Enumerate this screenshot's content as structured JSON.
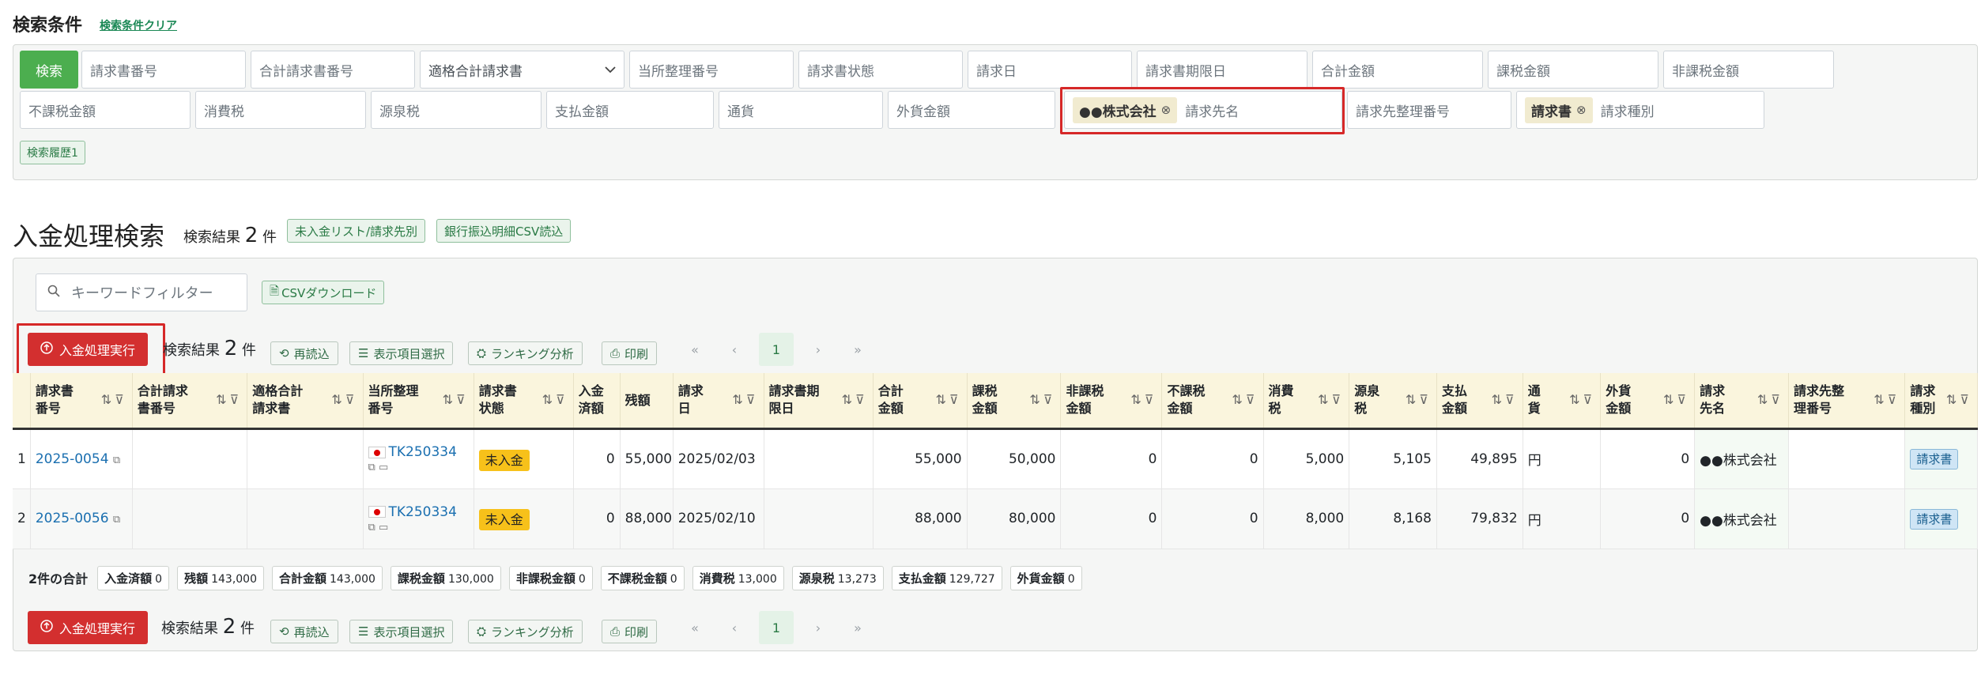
{
  "search": {
    "title": "検索条件",
    "clear": "検索条件クリア",
    "search_btn": "検索",
    "row1": [
      "請求書番号",
      "合計請求書番号",
      "適格合計請求書",
      "当所整理番号",
      "請求書状態",
      "請求日",
      "請求書期限日",
      "合計金額",
      "課税金額",
      "非課税金額"
    ],
    "row2": [
      "不課税金額",
      "消費税",
      "源泉税",
      "支払金額",
      "通貨",
      "外貨金額"
    ],
    "chip_company": "●●株式会社",
    "company_placeholder": "請求先名",
    "ref_no": "請求先整理番号",
    "chip_type": "請求書",
    "type_placeholder": "請求種別",
    "history_btn": "検索履歴1",
    "chevron": "chevron-down-icon",
    "remove": "⊗"
  },
  "heading": {
    "title": "入金処理検索",
    "result_prefix": "検索結果",
    "count": "2",
    "unit": "件",
    "btn_unpaid": "未入金リスト/請求先別",
    "btn_bank": "銀行振込明細CSV読込"
  },
  "toolbar": {
    "keyword_placeholder": "キーワードフィルター",
    "csv": "CSVダウンロード",
    "exec": "入金処理実行",
    "result_prefix": "検索結果",
    "count": "2",
    "unit": "件",
    "reload": "再読込",
    "columns": "表示項目選択",
    "ranking": "ランキング分析",
    "print": "印刷",
    "page_first": "«",
    "page_prev": "‹",
    "page_cur": "1",
    "page_next": "›",
    "page_last": "»"
  },
  "table": {
    "headers": [
      "請求書番号",
      "合計請求書番号",
      "適格合計請求書",
      "当所整理番号",
      "請求書状態",
      "入金済額",
      "残額",
      "請求日",
      "請求書期限日",
      "合計金額",
      "課税金額",
      "非課税金額",
      "不課税金額",
      "消費税",
      "源泉税",
      "支払金額",
      "通貨",
      "外貨金額",
      "請求先名",
      "請求先整理番号",
      "請求種別"
    ],
    "header_lines": [
      [
        "請求書",
        "番号"
      ],
      [
        "合計請求",
        "書番号"
      ],
      [
        "適格合計",
        "請求書"
      ],
      [
        "当所整理",
        "番号"
      ],
      [
        "請求書",
        "状態"
      ],
      [
        "入金",
        "済額"
      ],
      [
        "残額"
      ],
      [
        "請求",
        "日"
      ],
      [
        "請求書期",
        "限日"
      ],
      [
        "合計",
        "金額"
      ],
      [
        "課税",
        "金額"
      ],
      [
        "非課税",
        "金額"
      ],
      [
        "不課税",
        "金額"
      ],
      [
        "消費",
        "税"
      ],
      [
        "源泉",
        "税"
      ],
      [
        "支払",
        "金額"
      ],
      [
        "通",
        "貨"
      ],
      [
        "外貨",
        "金額"
      ],
      [
        "請求",
        "先名"
      ],
      [
        "請求先整",
        "理番号"
      ],
      [
        "請求",
        "種別"
      ]
    ],
    "rows": [
      {
        "idx": "1",
        "no": "2025-0054",
        "ref": "TK250334",
        "status": "未入金",
        "paid": "0",
        "remain": "55,000",
        "date": "2025/02/03",
        "total": "55,000",
        "taxable": "50,000",
        "nontax": "0",
        "untax": "0",
        "ctax": "5,000",
        "wtax": "5,105",
        "pay": "49,895",
        "cur": "円",
        "fx": "0",
        "client": "●●株式会社",
        "type": "請求書"
      },
      {
        "idx": "2",
        "no": "2025-0056",
        "ref": "TK250334",
        "status": "未入金",
        "paid": "0",
        "remain": "88,000",
        "date": "2025/02/10",
        "total": "88,000",
        "taxable": "80,000",
        "nontax": "0",
        "untax": "0",
        "ctax": "8,000",
        "wtax": "8,168",
        "pay": "79,832",
        "cur": "円",
        "fx": "0",
        "client": "●●株式会社",
        "type": "請求書"
      }
    ]
  },
  "totals": {
    "lead": "2件の合計",
    "items": [
      {
        "k": "入金済額",
        "v": "0"
      },
      {
        "k": "残額",
        "v": "143,000"
      },
      {
        "k": "合計金額",
        "v": "143,000"
      },
      {
        "k": "課税金額",
        "v": "130,000"
      },
      {
        "k": "非課税金額",
        "v": "0"
      },
      {
        "k": "不課税金額",
        "v": "0"
      },
      {
        "k": "消費税",
        "v": "13,000"
      },
      {
        "k": "源泉税",
        "v": "13,273"
      },
      {
        "k": "支払金額",
        "v": "129,727"
      },
      {
        "k": "外貨金額",
        "v": "0"
      }
    ]
  },
  "colors": {
    "accent": "#4cae4f",
    "danger": "#d32f2f",
    "highlight": "#d62828"
  }
}
